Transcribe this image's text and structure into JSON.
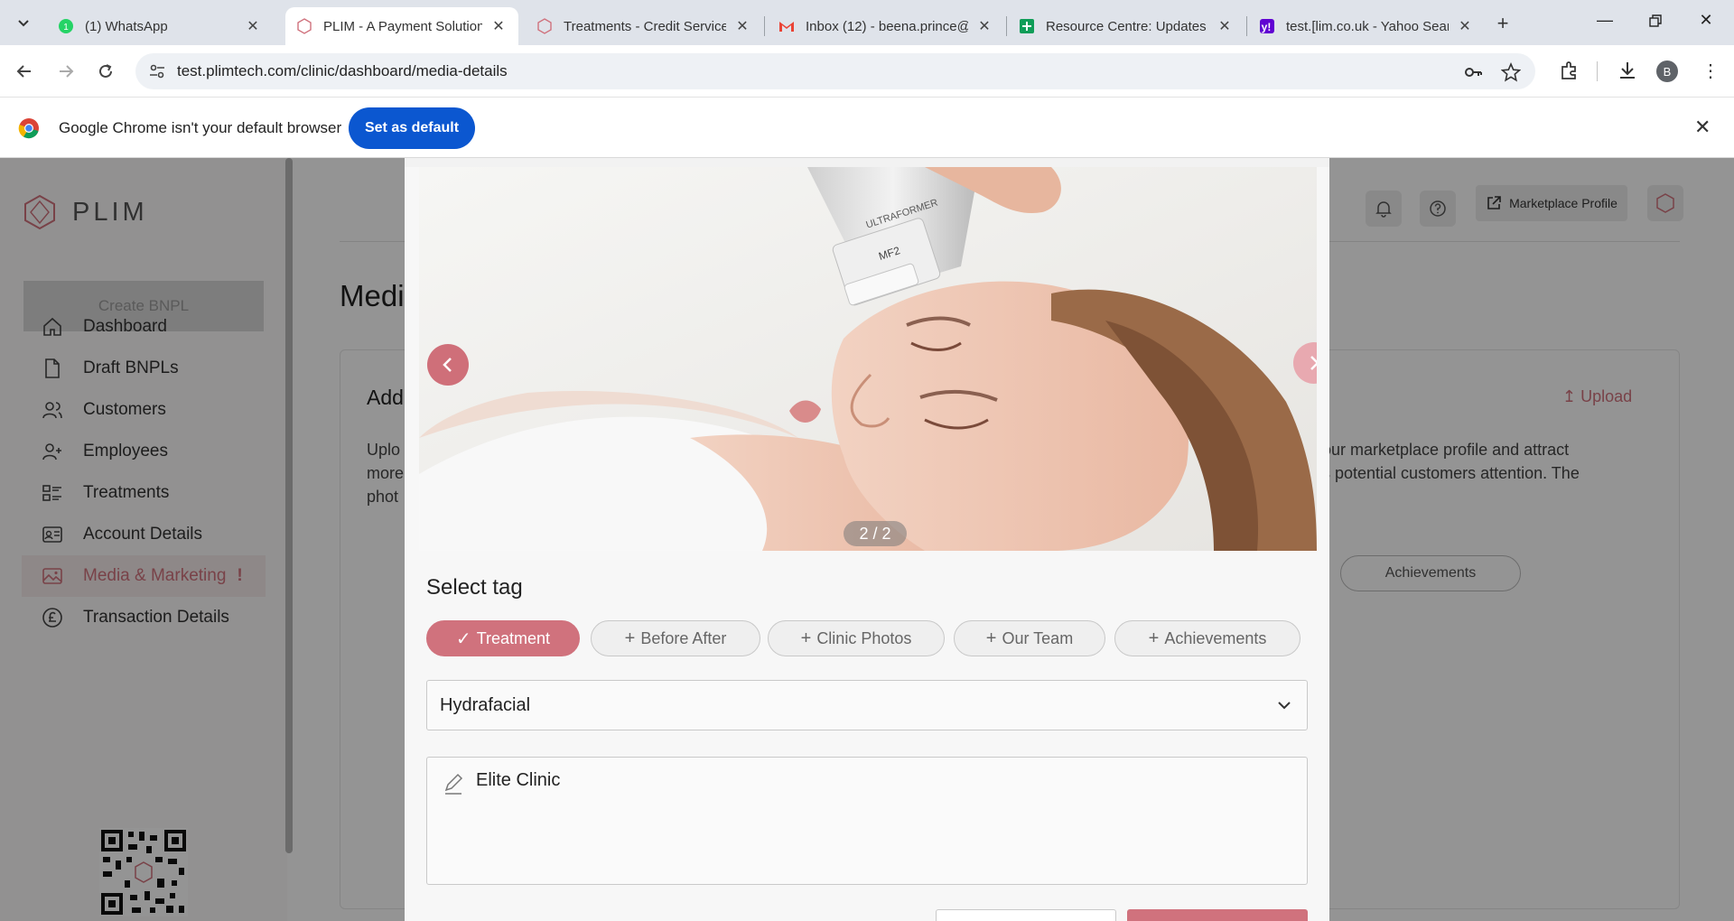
{
  "browser": {
    "tabs": [
      {
        "title": "(1) WhatsApp",
        "favicon": "whatsapp-icon"
      },
      {
        "title": "PLIM - A Payment Solution",
        "favicon": "plim-icon",
        "active": true
      },
      {
        "title": "Treatments - Credit Service",
        "favicon": "plim-icon"
      },
      {
        "title": "Inbox (12) - beena.prince@",
        "favicon": "gmail-icon"
      },
      {
        "title": "Resource Centre: Updates",
        "favicon": "sheets-icon"
      },
      {
        "title": "test.[lim.co.uk - Yahoo Sear",
        "favicon": "yahoo-icon"
      }
    ],
    "url": "test.plimtech.com/clinic/dashboard/media-details",
    "profile_initial": "B",
    "infobar": {
      "message": "Google Chrome isn't your default browser",
      "button": "Set as default"
    }
  },
  "app": {
    "brand": "PLIM",
    "create_button": "Create BNPL",
    "nav": [
      {
        "label": "Dashboard",
        "icon": "home-icon"
      },
      {
        "label": "Draft BNPLs",
        "icon": "document-icon"
      },
      {
        "label": "Customers",
        "icon": "users-icon"
      },
      {
        "label": "Employees",
        "icon": "user-plus-icon"
      },
      {
        "label": "Treatments",
        "icon": "list-icon"
      },
      {
        "label": "Account Details",
        "icon": "id-card-icon"
      },
      {
        "label": "Media & Marketing",
        "icon": "image-icon",
        "active": true,
        "alert": "!"
      },
      {
        "label": "Transaction Details",
        "icon": "pound-icon"
      }
    ],
    "header": {
      "marketplace_profile": "Marketplace Profile"
    },
    "page_title": "Medi",
    "card": {
      "title": "Add",
      "desc_left": "Uplo\nmore\nphot",
      "desc_right": "our marketplace profile and attract\ns potential customers attention. The",
      "upload": "Upload",
      "chip": "Achievements"
    }
  },
  "modal": {
    "carousel": {
      "counter": "2 / 2",
      "device_label": "ULTRAFORMER",
      "device_model": "MF2"
    },
    "select_tag_title": "Select tag",
    "tags": [
      {
        "label": "Treatment",
        "selected": true
      },
      {
        "label": "Before After",
        "selected": false
      },
      {
        "label": "Clinic Photos",
        "selected": false
      },
      {
        "label": "Our Team",
        "selected": false
      },
      {
        "label": "Achievements",
        "selected": false
      }
    ],
    "dropdown_value": "Hydrafacial",
    "caption": "Elite Clinic"
  },
  "colors": {
    "accent": "#d0727d",
    "chrome_blue": "#0b57d0"
  }
}
